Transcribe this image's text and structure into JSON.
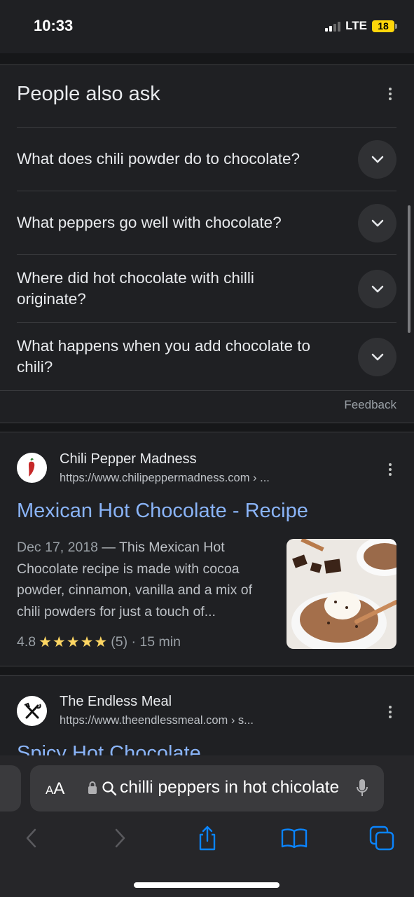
{
  "status": {
    "time": "10:33",
    "network": "LTE",
    "battery": "18"
  },
  "people_also_ask": {
    "title": "People also ask",
    "questions": [
      "What does chili powder do to chocolate?",
      "What peppers go well with chocolate?",
      "Where did hot chocolate with chilli originate?",
      "What happens when you add chocolate to chili?"
    ],
    "feedback": "Feedback"
  },
  "results": [
    {
      "site": "Chili Pepper Madness",
      "url": "https://www.chilipeppermadness.com › ...",
      "title": "Mexican Hot Chocolate - Recipe",
      "date": "Dec 17, 2018",
      "snippet": " — This Mexican Hot Chocolate recipe is made with cocoa powder, cinnamon, vanilla and a mix of chili powders for just a touch of...",
      "rating": "4.8",
      "stars": "★★★★★",
      "rating_meta": "(5) · 15 min",
      "logo_icon": "chili-pepper-icon"
    },
    {
      "site": "The Endless Meal",
      "url": "https://www.theendlessmeal.com › s...",
      "title": "Spicy Hot Chocolate",
      "logo_icon": "fork-knife-icon"
    }
  ],
  "browser": {
    "aa_label": "AA",
    "address_text": "chilli peppers in hot chicolate",
    "accent_color": "#0a84ff"
  }
}
